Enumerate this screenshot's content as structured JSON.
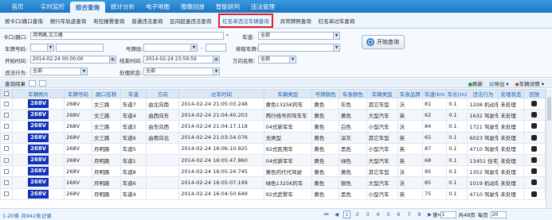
{
  "nav": {
    "tabs": [
      "首页",
      "实时监控",
      "综合查询",
      "统计分析",
      "电子地图",
      "图像回放",
      "智能研判",
      "违法管理"
    ],
    "active": 2
  },
  "subnav": {
    "items": [
      "按卡口/路口查询",
      "按行车轨迹查询",
      "布控报警查询",
      "普通违法查询",
      "区间超速违法查询",
      "红名单违法车辆查询",
      "异常牌照查询",
      "红名单过车查询"
    ],
    "selected": 5
  },
  "form": {
    "kakou_label": "卡口/路口:",
    "kakou_value": "月明路,文三路",
    "required_mark": "*",
    "chedao_label": "车道:",
    "chedao_value": "全部",
    "chepai_label": "车牌号码:",
    "haopai_label": "号牌段:",
    "dash": "-",
    "paichu_label": "排除车牌:",
    "start_label": "开始时间:",
    "start_value": "2014-02-24 00:00:00",
    "end_label": "结束时间:",
    "end_value": "2014-02-24 23:59:59",
    "fangxiang_label": "方向名称:",
    "fangxiang_value": "全部",
    "weifa_label": "违法行为:",
    "weifa_value": "全部",
    "chuli_label": "处理状态:",
    "chuli_value": "全部",
    "search_label": "开始查询"
  },
  "results": {
    "title": "查询结果",
    "refresh": "刷新",
    "export": "导出",
    "detail": "车辆详情"
  },
  "table": {
    "headers": [
      "",
      "车辆照片",
      "车牌号码",
      "路口名称",
      "车道",
      "方向",
      "过车时间",
      "车辆类型",
      "号牌颜色",
      "车身颜色",
      "车辆类型",
      "车身品牌",
      "车速(km",
      "车长(m)",
      "违法行为",
      "处理状态",
      "回放"
    ],
    "rows": [
      [
        "268V",
        "268V",
        "文三路",
        "车道7",
        "由北向南",
        "2014-02-24 21:05:03.248",
        "黄色1325K的车",
        "黄色",
        "灰色",
        "其它车型",
        "沃",
        "81",
        "0.1",
        "1208 机动车",
        "未处理"
      ],
      [
        "268V",
        "268V",
        "文三路",
        "车道4",
        "由西向东",
        "2014-02-24 21:04:40.203",
        "两行线号的驾车车",
        "黄色",
        "黄色",
        "大型汽车",
        "英",
        "62",
        "0.1",
        "1632 驾驶车",
        "未处理"
      ],
      [
        "268V",
        "268V",
        "文三路",
        "车道3",
        "由东向西",
        "2014-02-24 21:04:17.118",
        "04式新军车",
        "黄色",
        "白色",
        "小型汽车",
        "沃",
        "84",
        "0.1",
        "1721 驾驶车",
        "未处理"
      ],
      [
        "268V",
        "268V",
        "文三路",
        "车道6",
        "由南向北",
        "2014-02-24 21:03:54.076",
        "无类型",
        "黄色",
        "深灰",
        "其它车型",
        "英",
        "65",
        "0.1",
        "6023 驾驶车",
        "未处理"
      ],
      [
        "268V",
        "268V",
        "月明路",
        "车道5",
        "",
        "2014-02-24 16:06:10.925",
        "92式民用车",
        "黄色",
        "黑色",
        "小型汽车",
        "英",
        "87",
        "0.1",
        "4710 驾驶车",
        "未处理"
      ],
      [
        "268V",
        "268V",
        "月明路",
        "车道1",
        "",
        "2014-02-24 16:05:47.860",
        "04式新军车",
        "黄色",
        "绿色",
        "大型汽车",
        "英",
        "68",
        "0.1",
        "13451 住宅车",
        "未处理"
      ],
      [
        "268V",
        "268V",
        "月明路",
        "车道8",
        "",
        "2014-02-24 16:05:24.745",
        "黄色的代代驾驶",
        "黄色",
        "黄色",
        "其它车型",
        "沃",
        "95",
        "0.1",
        "1352 驾驶车",
        "未处理"
      ],
      [
        "268V",
        "268V",
        "月明路",
        "车道6",
        "",
        "2014-02-24 16:05:07.199",
        "绿色1325K的车",
        "黄色",
        "银色",
        "大型汽车",
        "沃",
        "85",
        "0.1",
        "1019 机动车",
        "未处理"
      ],
      [
        "268V",
        "268V",
        "月明路",
        "车道4",
        "",
        "2014-02-24 16:04:50.649",
        "92式武警车",
        "黄色",
        "黑色",
        "小型汽车",
        "英",
        "75",
        "0.1",
        "4710 驾驶车",
        "未处理"
      ]
    ]
  },
  "footer": {
    "summary": "1-20条 共942条记录",
    "pages": [
      "1",
      "2",
      "3",
      "4",
      "5",
      "6",
      "7",
      "8"
    ],
    "current": "1",
    "first": "第",
    "page_value": "1",
    "total_pages": "共48页",
    "per_page_label": "每页",
    "per_page": "20"
  }
}
